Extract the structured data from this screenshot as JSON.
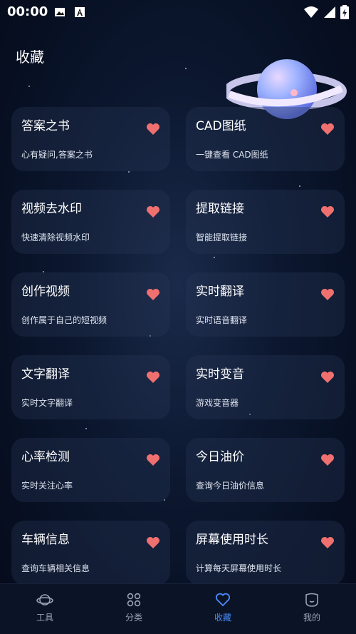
{
  "status": {
    "time": "00:00"
  },
  "page": {
    "title": "收藏"
  },
  "cards": [
    {
      "title": "答案之书",
      "subtitle": "心有疑问,答案之书"
    },
    {
      "title": "CAD图纸",
      "subtitle": "一键查看 CAD图纸"
    },
    {
      "title": "视频去水印",
      "subtitle": "快速清除视频水印"
    },
    {
      "title": "提取链接",
      "subtitle": "智能提取链接"
    },
    {
      "title": "创作视频",
      "subtitle": "创作属于自己的短视频"
    },
    {
      "title": "实时翻译",
      "subtitle": "实时语音翻译"
    },
    {
      "title": "文字翻译",
      "subtitle": "实时文字翻译"
    },
    {
      "title": "实时变音",
      "subtitle": "游戏变音器"
    },
    {
      "title": "心率检测",
      "subtitle": "实时关注心率"
    },
    {
      "title": "今日油价",
      "subtitle": "查询今日油价信息"
    },
    {
      "title": "车辆信息",
      "subtitle": "查询车辆相关信息"
    },
    {
      "title": "屏幕使用时长",
      "subtitle": "计算每天屏幕使用时长"
    }
  ],
  "nav": [
    {
      "label": "工具",
      "icon": "planet-icon"
    },
    {
      "label": "分类",
      "icon": "grid-icon"
    },
    {
      "label": "收藏",
      "icon": "heart-icon",
      "active": true
    },
    {
      "label": "我的",
      "icon": "profile-icon"
    }
  ],
  "colors": {
    "heart": "#f07070",
    "active": "#4a8bff",
    "inactive": "#9aa3b3"
  }
}
